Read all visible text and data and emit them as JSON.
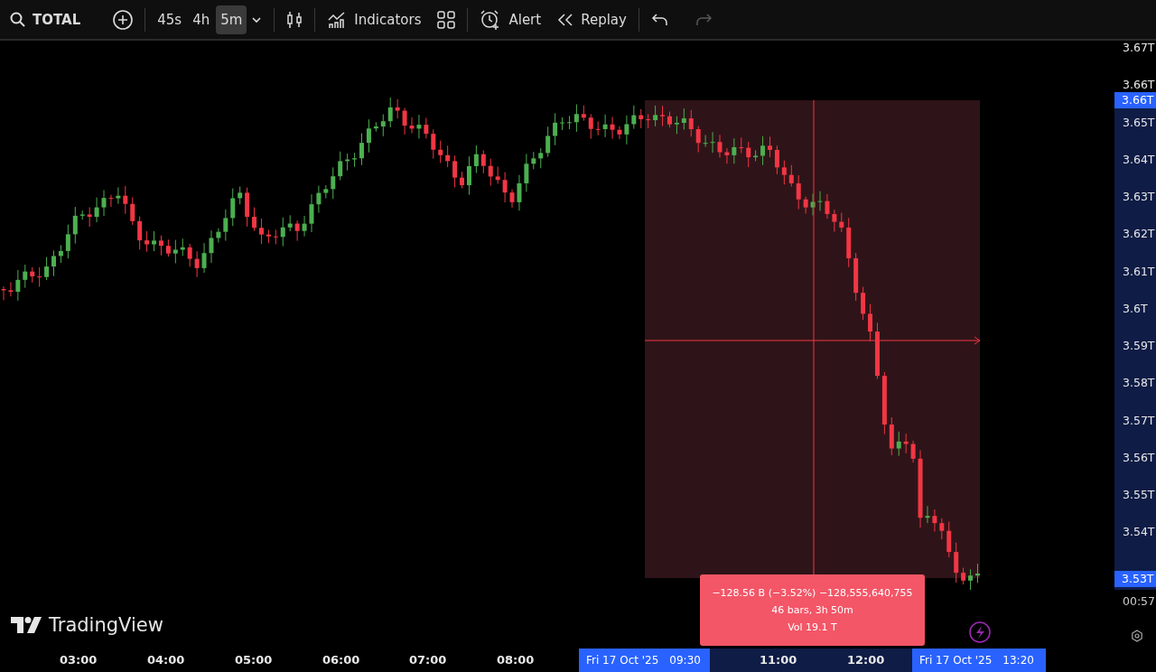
{
  "toolbar": {
    "symbol": "TOTAL",
    "intervals": [
      {
        "label": "45s",
        "selected": false
      },
      {
        "label": "4h",
        "selected": false
      },
      {
        "label": "5m",
        "selected": true
      }
    ],
    "indicators": "Indicators",
    "alert": "Alert",
    "replay": "Replay",
    "redo": {
      "disabled": true
    }
  },
  "chart": {
    "logo": "TradingView",
    "price_axis": {
      "labels": [
        "3.67T",
        "3.66T",
        "3.65T",
        "3.64T",
        "3.63T",
        "3.62T",
        "3.61T",
        "3.6T",
        "3.59T",
        "3.58T",
        "3.57T",
        "3.56T",
        "3.55T",
        "3.54T"
      ],
      "range_high": "3.66T",
      "last_price": "3.53T",
      "countdown": "00:57"
    },
    "time_axis": {
      "labels": [
        "03:00",
        "04:00",
        "05:00",
        "06:00",
        "07:00",
        "08:00",
        "11:00",
        "12:00"
      ],
      "range_start": {
        "date": "Fri 17 Oct '25",
        "time": "09:30"
      },
      "range_end": {
        "date": "Fri 17 Oct '25",
        "time": "13:20"
      }
    },
    "measurement": {
      "change": "−128.56 B (−3.52%) −128,555,640,755",
      "bars": "46 bars, 3h 50m",
      "volume": "Vol 19.1 T"
    }
  }
}
